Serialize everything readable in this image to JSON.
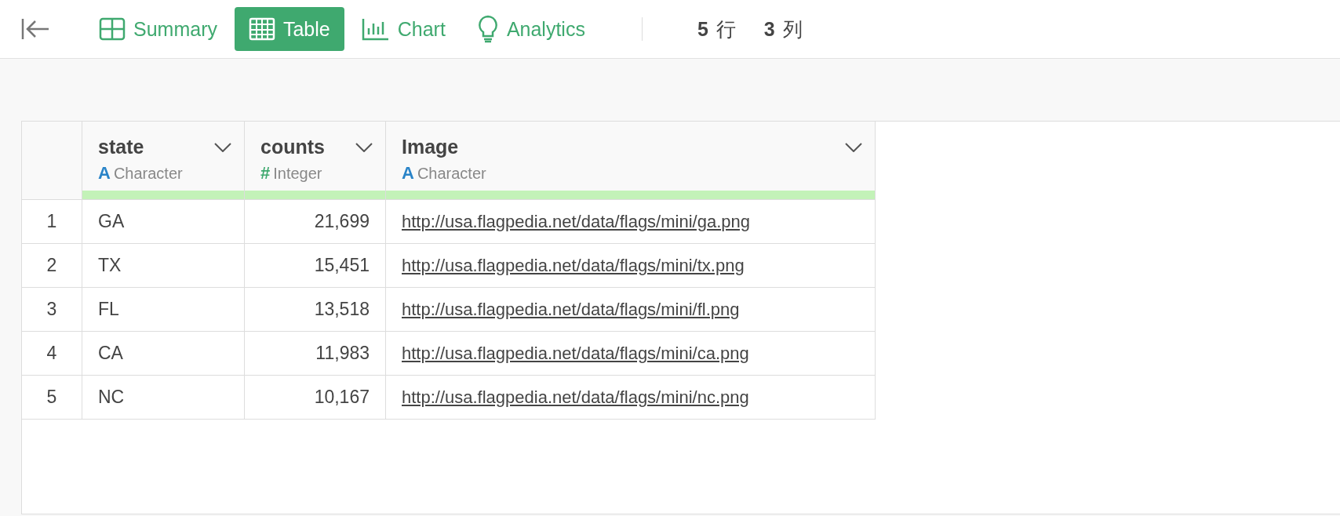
{
  "toolbar": {
    "tabs": [
      {
        "label": "Summary",
        "kind": "summary",
        "selected": false
      },
      {
        "label": "Table",
        "kind": "table",
        "selected": true
      },
      {
        "label": "Chart",
        "kind": "chart",
        "selected": false
      },
      {
        "label": "Analytics",
        "kind": "analytics",
        "selected": false
      }
    ],
    "row_count": {
      "value": "5",
      "unit": "行"
    },
    "column_count": {
      "value": "3",
      "unit": "列"
    }
  },
  "table": {
    "columns": [
      {
        "name": "state",
        "type": "Character",
        "type_symbol": "A",
        "kind": "character"
      },
      {
        "name": "counts",
        "type": "Integer",
        "type_symbol": "#",
        "kind": "integer"
      },
      {
        "name": "Image",
        "type": "Character",
        "type_symbol": "A",
        "kind": "character"
      }
    ],
    "rows": [
      {
        "index": "1",
        "cells": [
          "GA",
          "21,699",
          "http://usa.flagpedia.net/data/flags/mini/ga.png"
        ]
      },
      {
        "index": "2",
        "cells": [
          "TX",
          "15,451",
          "http://usa.flagpedia.net/data/flags/mini/tx.png"
        ]
      },
      {
        "index": "3",
        "cells": [
          "FL",
          "13,518",
          "http://usa.flagpedia.net/data/flags/mini/fl.png"
        ]
      },
      {
        "index": "4",
        "cells": [
          "CA",
          "11,983",
          "http://usa.flagpedia.net/data/flags/mini/ca.png"
        ]
      },
      {
        "index": "5",
        "cells": [
          "NC",
          "10,167",
          "http://usa.flagpedia.net/data/flags/mini/nc.png"
        ]
      }
    ]
  }
}
